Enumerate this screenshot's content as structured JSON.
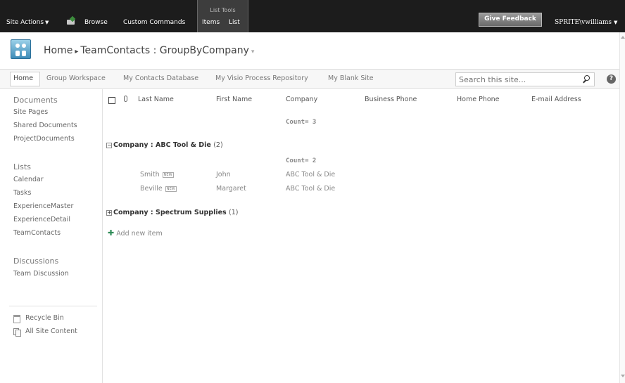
{
  "ribbon": {
    "site_actions": "Site Actions",
    "browse": "Browse",
    "custom_commands": "Custom Commands",
    "list_tools": "List Tools",
    "items_tab": "Items",
    "list_tab": "List",
    "feedback": "Give Feedback",
    "user": "SPRITE\\vwilliams"
  },
  "title": {
    "home": "Home",
    "list": "TeamContacts",
    "view": "GroupByCompany"
  },
  "topnav": {
    "items": [
      "Home",
      "Group Workspace",
      "My Contacts Database",
      "My Visio Process Repository",
      "My Blank Site"
    ],
    "search_placeholder": "Search this site..."
  },
  "quicklaunch": {
    "documents_heading": "Documents",
    "documents": [
      "Site Pages",
      "Shared Documents",
      "ProjectDocuments"
    ],
    "lists_heading": "Lists",
    "lists": [
      "Calendar",
      "Tasks",
      "ExperienceMaster",
      "ExperienceDetail",
      "TeamContacts"
    ],
    "discussions_heading": "Discussions",
    "discussions": [
      "Team Discussion"
    ],
    "recycle_bin": "Recycle Bin",
    "all_content": "All Site Content"
  },
  "list": {
    "columns": [
      "Last Name",
      "First Name",
      "Company",
      "Business Phone",
      "Home Phone",
      "E-mail Address"
    ],
    "total_count": "Count= 3",
    "new_badge": "NEW",
    "groups": [
      {
        "label": "Company : ABC Tool & Die",
        "count": "(2)",
        "expanded": true,
        "count_label": "Count= 2",
        "rows": [
          {
            "last": "Smith",
            "first": "John",
            "company": "ABC Tool & Die"
          },
          {
            "last": "Beville",
            "first": "Margaret",
            "company": "ABC Tool & Die"
          }
        ]
      },
      {
        "label": "Company : Spectrum Supplies",
        "count": "(1)",
        "expanded": false
      }
    ],
    "add_new": "Add new item"
  },
  "icons": {
    "navigate_up": "folder-up-icon",
    "search": "magnifier-icon",
    "help": "help-icon",
    "site_logo": "people-logo-icon",
    "recycle": "recycle-bin-icon",
    "all_content": "pages-icon",
    "attachment": "paperclip-icon",
    "add": "plus-icon"
  },
  "colors": {
    "ribbon": "#1c1c1c",
    "list_tools": "#3d3d3d",
    "add_icon": "#2e8b57"
  }
}
